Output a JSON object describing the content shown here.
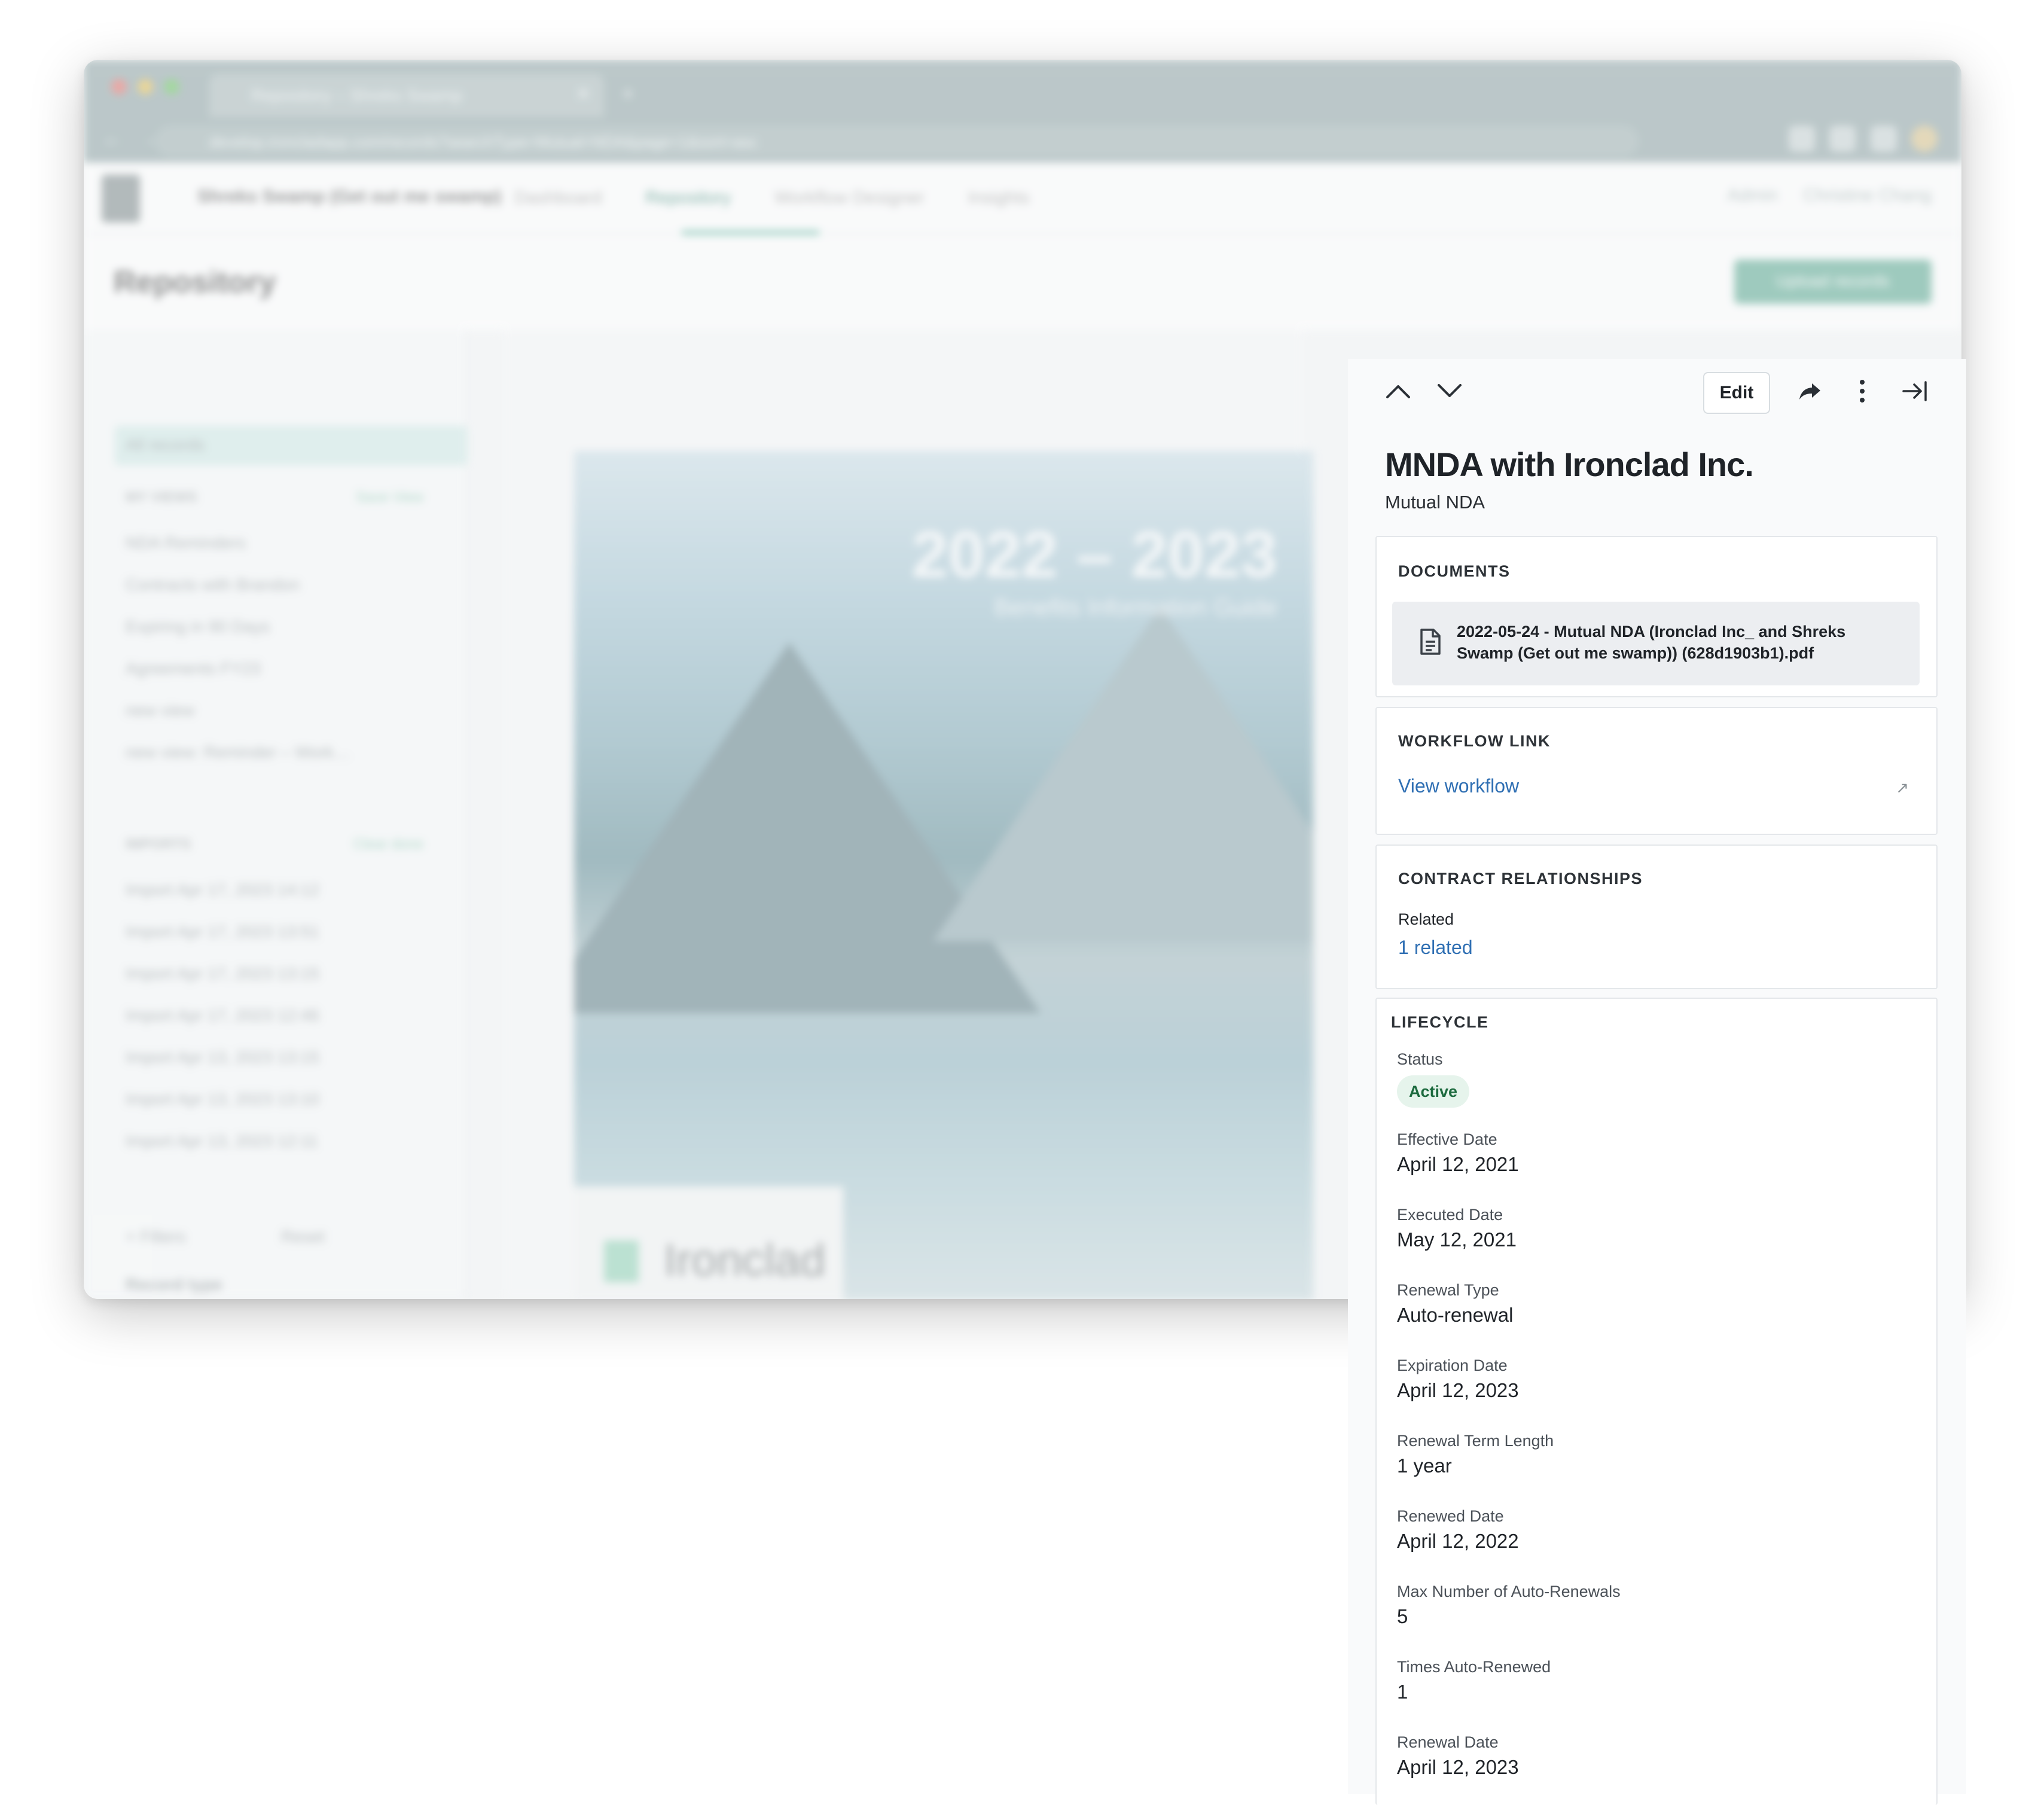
{
  "browser": {
    "tab_title": "Repository – Shreks Swamp",
    "url": "develop.ironcladapp.com/records?searchType=Mutual+NDA&page=1&sort=asc"
  },
  "app": {
    "workspace": "Shreks Swamp (Get out me swamp)",
    "nav": [
      "Dashboard",
      "Repository",
      "Workflow Designer",
      "Insights"
    ],
    "admin_label": "Admin",
    "user_name": "Christine Chang"
  },
  "page": {
    "title": "Repository",
    "upload_button": "Upload records"
  },
  "sidebar": {
    "all_records": "All records",
    "my_views_heading": "MY VIEWS",
    "save_view": "Save View",
    "views": [
      "NDA Reminders",
      "Contracts with Brandon",
      "Expiring in 90 Days",
      "Agreements FY23",
      "new view",
      "new view: Reminder – Work…"
    ],
    "imports_heading": "IMPORTS",
    "clear_done": "Clear done",
    "imports": [
      "Import Apr 17, 2023 14:12",
      "Import Apr 17, 2023 13:51",
      "Import Apr 17, 2023 13:15",
      "Import Apr 17, 2023 12:46",
      "Import Apr 13, 2023 13:15",
      "Import Apr 13, 2023 13:10",
      "Import Apr 13, 2023 12:11"
    ],
    "filters_button": "+ Filters",
    "reset_button": "Reset",
    "record_type_label": "Record type"
  },
  "document_preview": {
    "year": "2022 – 2023",
    "subtitle": "Benefits Information Guide",
    "brand": "Ironclad"
  },
  "detail": {
    "toolbar": {
      "edit": "Edit"
    },
    "title": "MNDA with Ironclad Inc.",
    "subtitle": "Mutual NDA",
    "documents": {
      "heading": "DOCUMENTS",
      "file_name": "2022-05-24 - Mutual NDA (Ironclad Inc_ and Shreks Swamp (Get out me swamp)) (628d1903b1).pdf"
    },
    "workflow_link": {
      "heading": "WORKFLOW LINK",
      "link_text": "View workflow"
    },
    "relationships": {
      "heading": "CONTRACT RELATIONSHIPS",
      "label": "Related",
      "link_text": "1 related"
    },
    "lifecycle": {
      "heading": "LIFECYCLE",
      "status_label": "Status",
      "status_value": "Active",
      "fields": [
        {
          "label": "Effective Date",
          "value": "April 12, 2021"
        },
        {
          "label": "Executed Date",
          "value": "May 12, 2021"
        },
        {
          "label": "Renewal Type",
          "value": "Auto-renewal"
        },
        {
          "label": "Expiration Date",
          "value": "April 12, 2023"
        },
        {
          "label": "Renewal Term Length",
          "value": "1 year"
        },
        {
          "label": "Renewed Date",
          "value": "April 12, 2022"
        },
        {
          "label": "Max Number of Auto-Renewals",
          "value": "5"
        },
        {
          "label": "Times Auto-Renewed",
          "value": "1"
        },
        {
          "label": "Renewal Date",
          "value": "April 12, 2023"
        }
      ]
    }
  },
  "colors": {
    "link": "#2f6fb3",
    "status_bg": "#e6f4ec",
    "status_text": "#1d6b3f",
    "brand_accent": "#2f9e83"
  }
}
